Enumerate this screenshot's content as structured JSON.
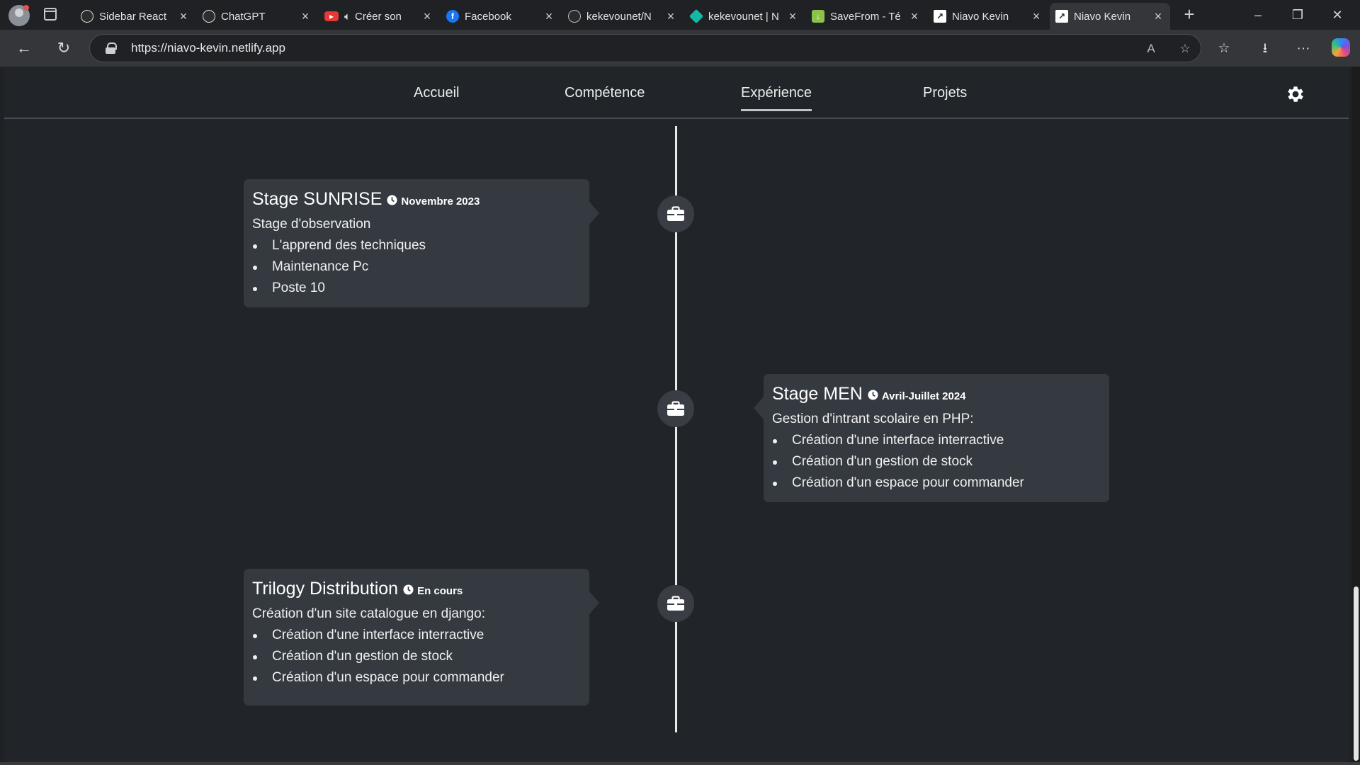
{
  "browser": {
    "tabs": [
      {
        "title": "Sidebar React",
        "favicon": "chatgpt-icon",
        "color": "#2d2d2d",
        "active": false
      },
      {
        "title": "ChatGPT",
        "favicon": "chatgpt-icon",
        "color": "#2d2d2d",
        "active": false
      },
      {
        "title": "Créer son",
        "favicon": "youtube-icon",
        "color": "#e53935",
        "audio": true,
        "active": false
      },
      {
        "title": "Facebook",
        "favicon": "facebook-icon",
        "color": "#1877f2",
        "active": false
      },
      {
        "title": "kekevounet/N",
        "favicon": "github-icon",
        "color": "#2b2b2b",
        "active": false
      },
      {
        "title": "kekevounet | N",
        "favicon": "netlify-icon",
        "color": "#14b8a6",
        "active": false
      },
      {
        "title": "SaveFrom - Té",
        "favicon": "savefrom-icon",
        "color": "#8bc34a",
        "active": false
      },
      {
        "title": "Niavo Kevin",
        "favicon": "chart-icon",
        "color": "#ffffff",
        "active": false
      },
      {
        "title": "Niavo Kevin",
        "favicon": "chart-icon",
        "color": "#ffffff",
        "active": true
      }
    ],
    "url": "https://niavo-kevin.netlify.app"
  },
  "nav": {
    "links": [
      "Accueil",
      "Compétence",
      "Expérience",
      "Projets"
    ],
    "active": "Expérience"
  },
  "timeline": [
    {
      "side": "left",
      "title": "Stage SUNRISE",
      "date": "Novembre 2023",
      "description": "Stage d'observation",
      "items": [
        "L'apprend des techniques",
        "Maintenance Pc",
        "Poste 10"
      ]
    },
    {
      "side": "right",
      "title": "Stage MEN",
      "date": "Avril-Juillet 2024",
      "description": "Gestion d'intrant scolaire en PHP:",
      "items": [
        "Création d'une interface interractive",
        "Création d'un gestion de stock",
        "Création d'un espace pour commander"
      ]
    },
    {
      "side": "left",
      "title": "Trilogy Distribution",
      "date": "En cours",
      "description": "Création d'un site catalogue en django:",
      "items": [
        "Création d'une interface interractive",
        "Création d'un gestion de stock",
        "Création d'un espace pour commander"
      ]
    }
  ],
  "colors": {
    "page_bg": "#212529",
    "card_bg": "#343a40",
    "timeline_line": "#e9e9e9"
  }
}
